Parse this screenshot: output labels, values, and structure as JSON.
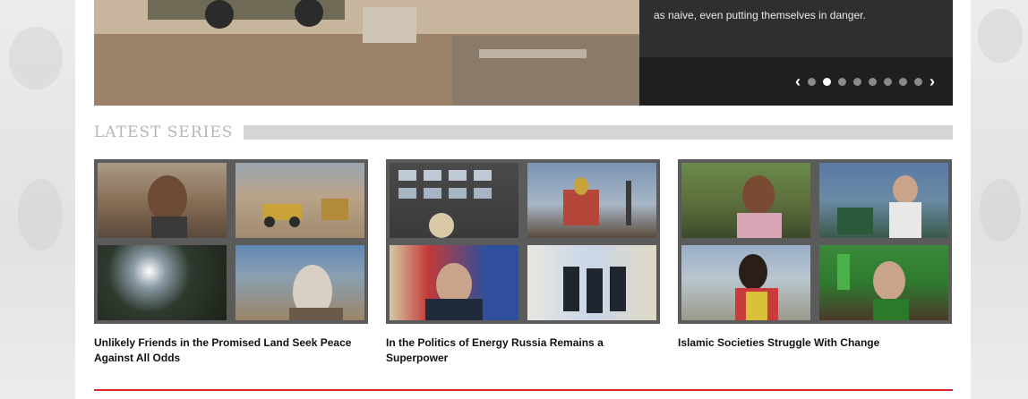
{
  "hero": {
    "caption": "as naive, even putting themselves in danger.",
    "slides_total": 8,
    "active_slide": 2,
    "prev_glyph": "‹",
    "next_glyph": "›"
  },
  "latest_series": {
    "heading": "LATEST SERIES",
    "items": [
      {
        "title": "Unlikely Friends in the Promised Land Seek Peace Against All Odds"
      },
      {
        "title": "In the Politics of Energy Russia Remains a Superpower"
      },
      {
        "title": "Islamic Societies Struggle With Change"
      }
    ]
  },
  "colors": {
    "accent_red": "#d9252a",
    "frame_gray": "#5b5b5b",
    "caption_bg": "#2f2f2f"
  }
}
